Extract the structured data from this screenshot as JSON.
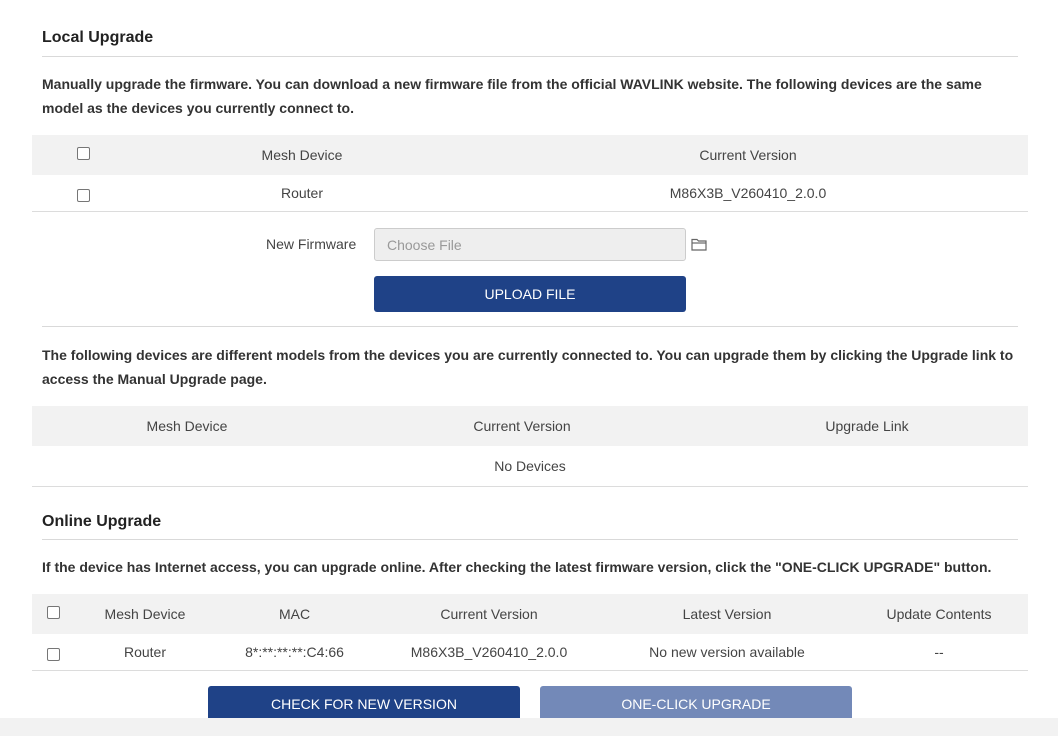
{
  "local": {
    "title": "Local Upgrade",
    "description": "Manually upgrade the firmware. You can download a new firmware file from the official WAVLINK website. The following devices are the same model as the devices you currently connect to.",
    "table": {
      "headers": {
        "device": "Mesh Device",
        "version": "Current Version"
      },
      "rows": [
        {
          "device": "Router",
          "version": "M86X3B_V260410_2.0.0"
        }
      ]
    },
    "new_firmware_label": "New Firmware",
    "file_placeholder": "Choose File",
    "upload_button": "UPLOAD FILE"
  },
  "different": {
    "description": "The following devices are different models from the devices you are currently connected to. You can upgrade them by clicking the Upgrade link to access the Manual Upgrade page.",
    "headers": {
      "device": "Mesh Device",
      "version": "Current Version",
      "link": "Upgrade Link"
    },
    "empty": "No Devices"
  },
  "online": {
    "title": "Online Upgrade",
    "description": "If the device has Internet access, you can upgrade online. After checking the latest firmware version, click the \"ONE-CLICK UPGRADE\" button.",
    "headers": {
      "device": "Mesh Device",
      "mac": "MAC",
      "current": "Current Version",
      "latest": "Latest Version",
      "contents": "Update Contents"
    },
    "rows": [
      {
        "device": "Router",
        "mac": "8*:**:**:**:C4:66",
        "current": "M86X3B_V260410_2.0.0",
        "latest": "No new version available",
        "contents": "--"
      }
    ],
    "check_button": "CHECK FOR NEW VERSION",
    "oneclick_button": "ONE-CLICK UPGRADE"
  },
  "colors": {
    "primary": "#1f4287",
    "disabled": "#7389b8",
    "header_bg": "#f2f2f2"
  }
}
